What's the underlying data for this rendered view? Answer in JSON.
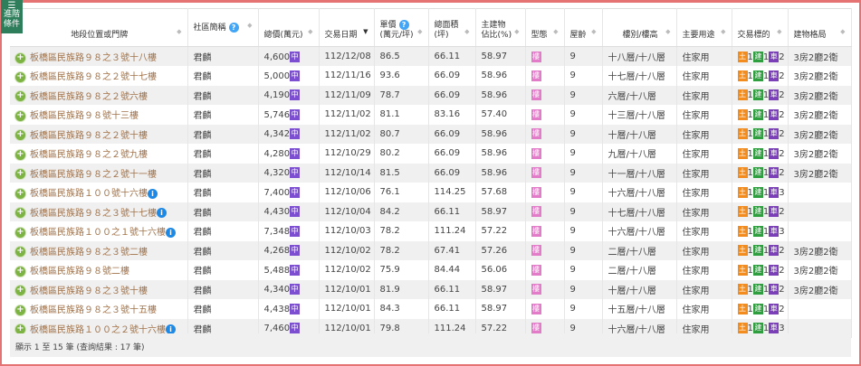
{
  "advanced_button": {
    "line1": "進階",
    "line2": "條件"
  },
  "headers": [
    "地段位置或門牌",
    "社區簡稱",
    "總價(萬元)",
    "交易日期",
    "單價",
    "總面積",
    "主建物",
    "型態",
    "屋齡",
    "樓別/樓高",
    "主要用途",
    "交易標的",
    "建物格局"
  ],
  "headers_sub": {
    "unit": "(萬元/坪)",
    "area": "(坪)",
    "ratio": "佔比(%)"
  },
  "tags": {
    "price": "中",
    "type": "樓",
    "land": "土",
    "build": "建",
    "park": "車"
  },
  "colors": {
    "land": "#f28c1e",
    "build": "#2e9e3e",
    "park": "#7b3fb8",
    "type": "#e37cc8",
    "price": "#7b4fd0"
  },
  "rows": [
    [
      "板橋區民族路９８之３號十八樓",
      "君麟",
      "4,600",
      "112/12/08",
      "86.5",
      "66.11",
      "58.97",
      "9",
      "十八層/十八層",
      "住家用",
      "1",
      "1",
      "2",
      "3房2廳2衛",
      false
    ],
    [
      "板橋區民族路９８之２號十七樓",
      "君麟",
      "5,000",
      "112/11/16",
      "93.6",
      "66.09",
      "58.96",
      "9",
      "十七層/十八層",
      "住家用",
      "1",
      "1",
      "2",
      "3房2廳2衛",
      false
    ],
    [
      "板橋區民族路９８之２號六樓",
      "君麟",
      "4,190",
      "112/11/09",
      "78.7",
      "66.09",
      "58.96",
      "9",
      "六層/十八層",
      "住家用",
      "1",
      "1",
      "2",
      "3房2廳2衛",
      false
    ],
    [
      "板橋區民族路９８號十三樓",
      "君麟",
      "5,746",
      "112/11/02",
      "81.1",
      "83.16",
      "57.40",
      "9",
      "十三層/十八層",
      "住家用",
      "1",
      "1",
      "2",
      "3房2廳2衛",
      false
    ],
    [
      "板橋區民族路９８之２號十樓",
      "君麟",
      "4,342",
      "112/11/02",
      "80.7",
      "66.09",
      "58.96",
      "9",
      "十層/十八層",
      "住家用",
      "1",
      "1",
      "2",
      "3房2廳2衛",
      false
    ],
    [
      "板橋區民族路９８之２號九樓",
      "君麟",
      "4,280",
      "112/10/29",
      "80.2",
      "66.09",
      "58.96",
      "9",
      "九層/十八層",
      "住家用",
      "1",
      "1",
      "2",
      "3房2廳2衛",
      false
    ],
    [
      "板橋區民族路９８之２號十一樓",
      "君麟",
      "4,320",
      "112/10/14",
      "81.5",
      "66.09",
      "58.96",
      "9",
      "十一層/十八層",
      "住家用",
      "1",
      "1",
      "2",
      "3房2廳2衛",
      false
    ],
    [
      "板橋區民族路１００號十六樓",
      "君麟",
      "7,400",
      "112/10/06",
      "76.1",
      "114.25",
      "57.68",
      "9",
      "十六層/十八層",
      "住家用",
      "1",
      "1",
      "3",
      "",
      true
    ],
    [
      "板橋區民族路９８之３號十七樓",
      "君麟",
      "4,430",
      "112/10/04",
      "84.2",
      "66.11",
      "58.97",
      "9",
      "十七層/十八層",
      "住家用",
      "1",
      "1",
      "2",
      "",
      true
    ],
    [
      "板橋區民族路１００之１號十六樓",
      "君麟",
      "7,348",
      "112/10/03",
      "78.2",
      "111.24",
      "57.22",
      "9",
      "十六層/十八層",
      "住家用",
      "1",
      "1",
      "3",
      "",
      true
    ],
    [
      "板橋區民族路９８之３號二樓",
      "君麟",
      "4,268",
      "112/10/02",
      "78.2",
      "67.41",
      "57.26",
      "9",
      "二層/十八層",
      "住家用",
      "1",
      "1",
      "2",
      "3房2廳2衛",
      false
    ],
    [
      "板橋區民族路９８號二樓",
      "君麟",
      "5,488",
      "112/10/02",
      "75.9",
      "84.44",
      "56.06",
      "9",
      "二層/十八層",
      "住家用",
      "1",
      "1",
      "2",
      "3房2廳2衛",
      false
    ],
    [
      "板橋區民族路９８之３號十樓",
      "君麟",
      "4,340",
      "112/10/01",
      "81.9",
      "66.11",
      "58.97",
      "9",
      "十層/十八層",
      "住家用",
      "1",
      "1",
      "2",
      "3房2廳2衛",
      false
    ],
    [
      "板橋區民族路９８之３號十五樓",
      "君麟",
      "4,438",
      "112/10/01",
      "84.3",
      "66.11",
      "58.97",
      "9",
      "十五層/十八層",
      "住家用",
      "1",
      "1",
      "2",
      "",
      false
    ],
    [
      "板橋區民族路１００之２號十六樓",
      "君麟",
      "7,460",
      "112/10/01",
      "79.8",
      "111.24",
      "57.22",
      "9",
      "十六層/十八層",
      "住家用",
      "1",
      "1",
      "3",
      "",
      true
    ]
  ],
  "footer": "顯示 1 至 15 筆 (查詢結果 : 17 筆)"
}
